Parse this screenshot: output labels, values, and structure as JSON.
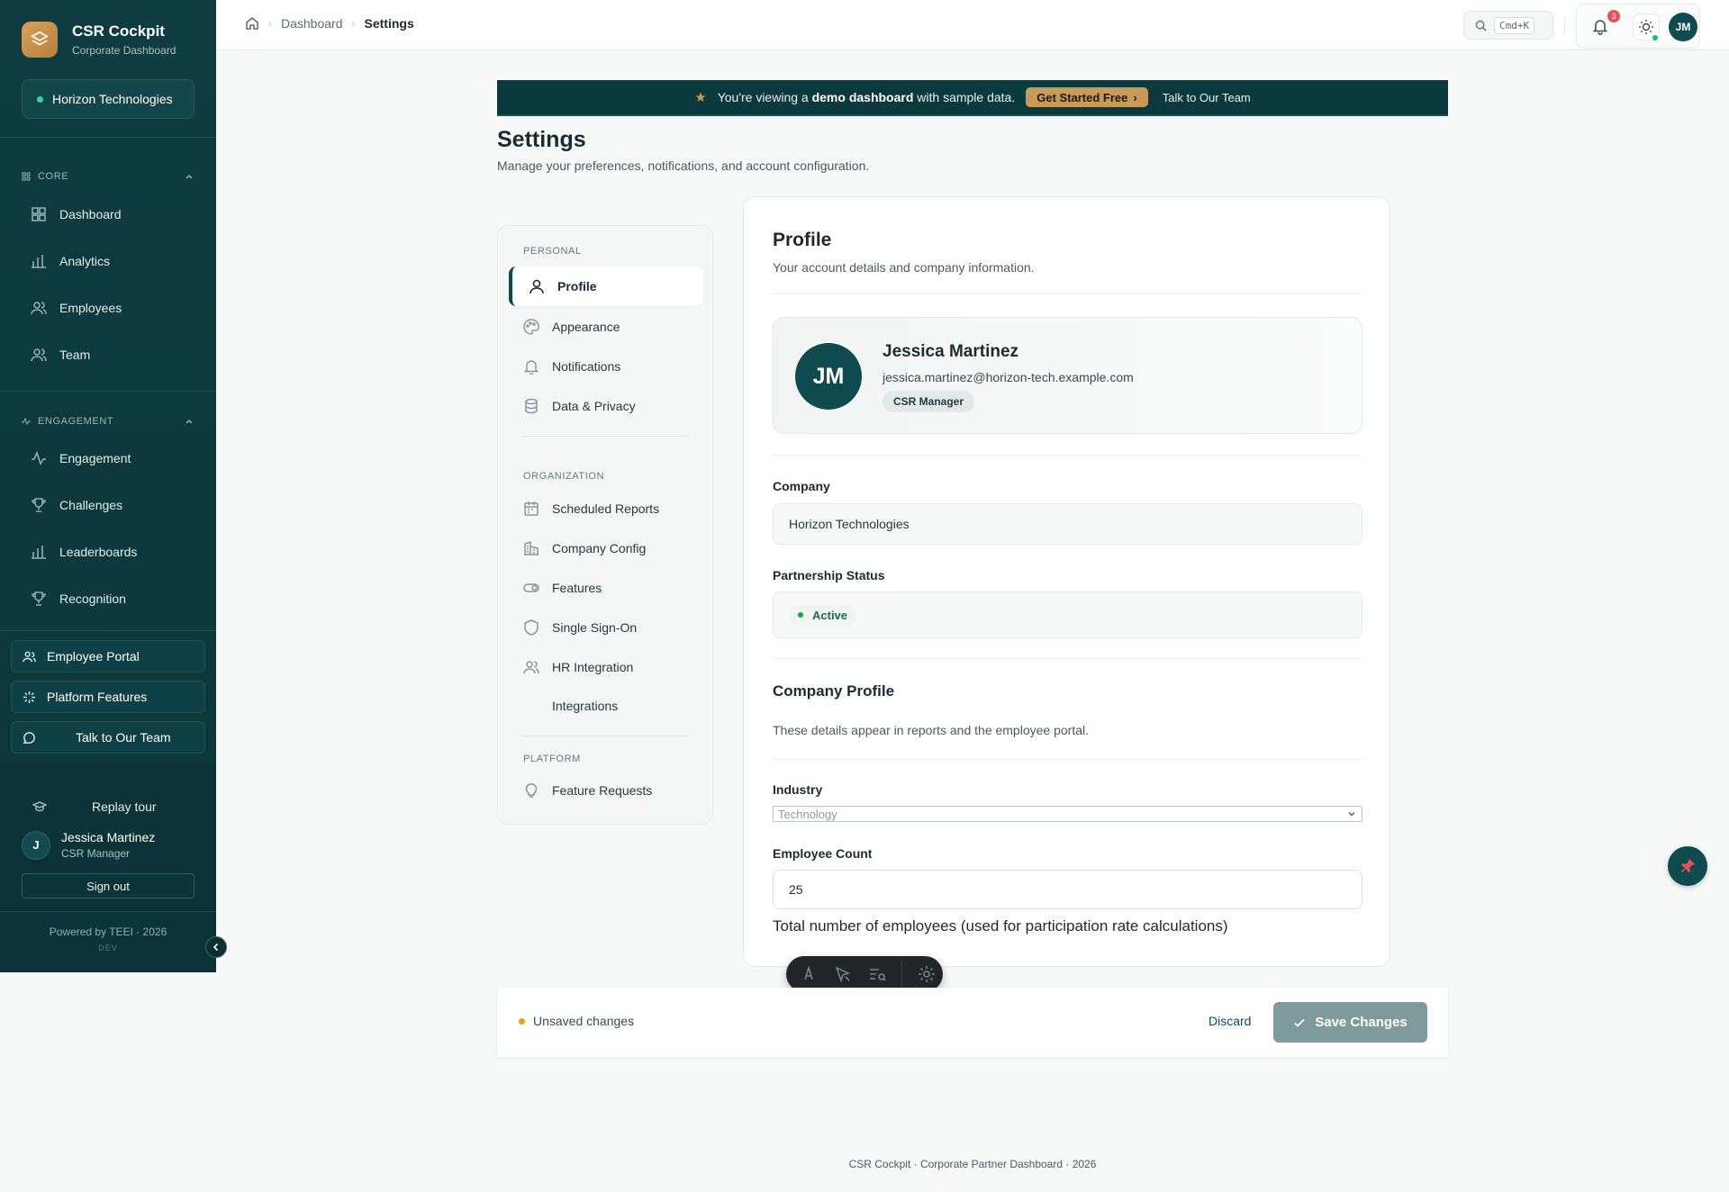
{
  "brand": {
    "title": "CSR Cockpit",
    "subtitle": "Corporate Dashboard",
    "org": "Horizon Technologies"
  },
  "sidebar": {
    "sections": [
      {
        "label": "CORE",
        "items": [
          "Dashboard",
          "Analytics",
          "Employees",
          "Team"
        ]
      },
      {
        "label": "ENGAGEMENT",
        "items": [
          "Engagement",
          "Challenges",
          "Leaderboards",
          "Recognition"
        ]
      }
    ],
    "buttons": [
      "Employee Portal",
      "Platform Features",
      "Talk to Our Team"
    ],
    "replay": "Replay tour",
    "user": {
      "initial": "J",
      "name": "Jessica Martinez",
      "role": "CSR Manager"
    },
    "signout": "Sign out",
    "powered": "Powered by TEEI · 2026",
    "env": "DEV"
  },
  "topbar": {
    "breadcrumb": [
      "Dashboard",
      "Settings"
    ],
    "search_shortcut": "Cmd+K",
    "notifications_count": "3",
    "avatar": "JM"
  },
  "banner": {
    "prefix": "You're viewing a",
    "bold": "demo dashboard",
    "suffix": "with sample data.",
    "cta": "Get Started Free",
    "talk": "Talk to Our Team"
  },
  "page": {
    "title": "Settings",
    "subtitle": "Manage your preferences, notifications, and account configuration."
  },
  "settings_nav": {
    "personal_label": "PERSONAL",
    "personal": [
      "Profile",
      "Appearance",
      "Notifications",
      "Data & Privacy"
    ],
    "org_label": "ORGANIZATION",
    "organization": [
      "Scheduled Reports",
      "Company Config",
      "Features",
      "Single Sign-On",
      "HR Integration",
      "Integrations"
    ],
    "platform_label": "PLATFORM",
    "platform": [
      "Feature Requests"
    ]
  },
  "profile": {
    "title": "Profile",
    "subtitle": "Your account details and company information.",
    "avatar": "JM",
    "name": "Jessica Martinez",
    "email": "jessica.martinez@horizon-tech.example.com",
    "role": "CSR Manager",
    "company_label": "Company",
    "company_value": "Horizon Technologies",
    "partnership_label": "Partnership Status",
    "partnership_value": "Active",
    "company_profile_title": "Company Profile",
    "company_profile_sub": "These details appear in reports and the employee portal.",
    "industry_label": "Industry",
    "industry_value": "Technology",
    "employee_count_label": "Employee Count",
    "employee_count_value": "25",
    "employee_count_help": "Total number of employees (used for participation rate calculations)"
  },
  "savebar": {
    "status": "Unsaved changes",
    "discard": "Discard",
    "save": "Save Changes"
  },
  "footer": "CSR Cockpit  ·  Corporate Partner Dashboard  ·  2026",
  "colors": {
    "sidebar_bg": "#0e3c41",
    "accent": "#0f4a4f",
    "cta": "#c99a55",
    "unsaved": "#f59e0b",
    "active": "#16a34a"
  }
}
